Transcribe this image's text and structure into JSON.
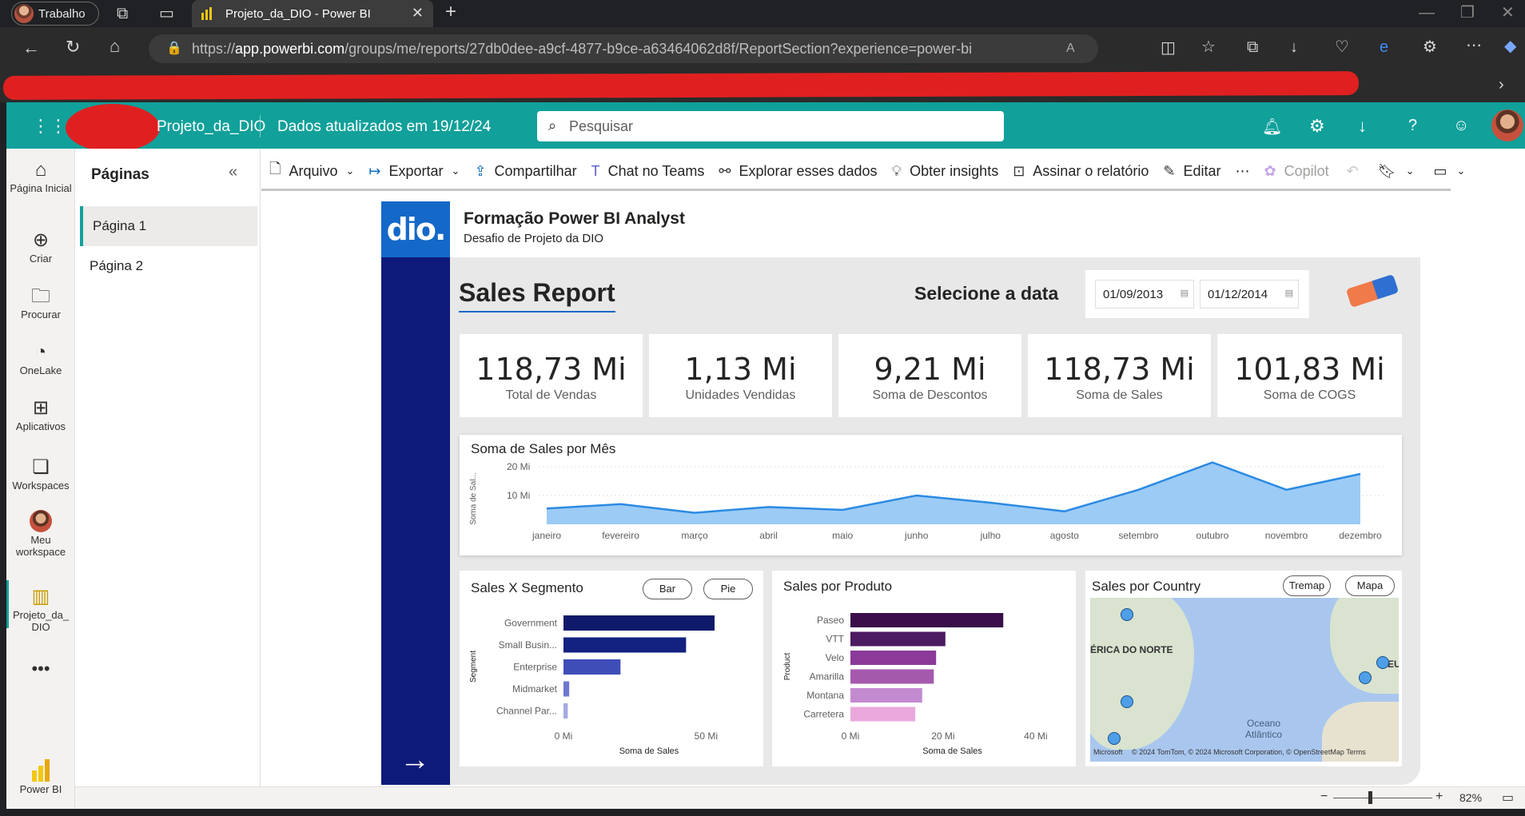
{
  "browser": {
    "profile": "Trabalho",
    "tab_title": "Projeto_da_DIO - Power BI",
    "url_prefix": "https://",
    "url_host": "app.powerbi.com",
    "url_path": "/groups/me/reports/27db0dee-a9cf-4877-b9ce-a63464062d8f/ReportSection?experience=power-bi"
  },
  "header": {
    "report_name": "Projeto_da_DIO",
    "refresh_text": "Dados atualizados em 19/12/24",
    "search_placeholder": "Pesquisar"
  },
  "rail": [
    {
      "label": "Página Inicial",
      "icon": "home-icon"
    },
    {
      "label": "Criar",
      "icon": "plus-circle-icon"
    },
    {
      "label": "Procurar",
      "icon": "folder-icon"
    },
    {
      "label": "OneLake",
      "icon": "onelake-icon"
    },
    {
      "label": "Aplicativos",
      "icon": "apps-icon"
    },
    {
      "label": "Workspaces",
      "icon": "workspaces-icon"
    },
    {
      "label": "Meu workspace",
      "icon": "avatar-icon"
    },
    {
      "label": "Projeto_da_ DIO",
      "icon": "report-icon"
    },
    {
      "label": "Power BI",
      "icon": "powerbi-icon"
    }
  ],
  "pages_pane": {
    "title": "Páginas",
    "pages": [
      "Página 1",
      "Página 2"
    ]
  },
  "toolbar": {
    "arquivo": "Arquivo",
    "exportar": "Exportar",
    "compartilhar": "Compartilhar",
    "teams": "Chat no Teams",
    "explorar": "Explorar esses dados",
    "insights": "Obter insights",
    "assinar": "Assinar o relatório",
    "editar": "Editar",
    "copilot": "Copilot"
  },
  "report": {
    "logo": "dio.",
    "title": "Formação Power BI Analyst",
    "subtitle": "Desafio de Projeto da DIO",
    "heading": "Sales Report",
    "date_label": "Selecione a data",
    "date_from": "01/09/2013",
    "date_to": "01/12/2014",
    "kpis": [
      {
        "value": "118,73 Mi",
        "label": "Total de Vendas"
      },
      {
        "value": "1,13 Mi",
        "label": "Unidades Vendidas"
      },
      {
        "value": "9,21 Mi",
        "label": "Soma de Descontos"
      },
      {
        "value": "118,73 Mi",
        "label": "Soma de  Sales"
      },
      {
        "value": "101,83 Mi",
        "label": "Soma de COGS"
      }
    ]
  },
  "chart_data": [
    {
      "type": "area",
      "title": "Soma de Sales por Mês",
      "ylabel": "Soma de Sal...",
      "y_ticks": [
        "20 Mi",
        "10 Mi"
      ],
      "categories": [
        "janeiro",
        "fevereiro",
        "março",
        "abril",
        "maio",
        "junho",
        "julho",
        "agosto",
        "setembro",
        "outubro",
        "novembro",
        "dezembro"
      ],
      "values": [
        5.5,
        7,
        4,
        6,
        5,
        10,
        7.5,
        4.5,
        12,
        21.5,
        12,
        17.5
      ],
      "ylim": [
        0,
        25
      ],
      "color": "#2b8ae3",
      "fill": "#9ccbf5"
    },
    {
      "type": "bar",
      "title": "Sales X Segmento",
      "ylabel": "Segment",
      "xlabel": "Soma de Sales",
      "x_ticks": [
        "0 Mi",
        "50 Mi"
      ],
      "categories": [
        "Government",
        "Small Busin...",
        "Enterprise",
        "Midmarket",
        "Channel Par..."
      ],
      "values": [
        53,
        43,
        20,
        2,
        1.5
      ],
      "xlim": [
        0,
        60
      ],
      "colors": [
        "#0f1a6b",
        "#132180",
        "#3f4db8",
        "#6d78d0",
        "#a3aae2"
      ],
      "buttons": [
        "Bar",
        "Pie"
      ]
    },
    {
      "type": "bar",
      "title": "Sales por Produto",
      "ylabel": "Product",
      "xlabel": "Soma de Sales",
      "x_ticks": [
        "0 Mi",
        "20 Mi",
        "40 Mi"
      ],
      "categories": [
        "Paseo",
        "VTT",
        "Velo",
        "Amarilla",
        "Montana",
        "Carretera"
      ],
      "values": [
        33,
        20.5,
        18.5,
        18,
        15.5,
        14
      ],
      "xlim": [
        0,
        44
      ],
      "colors": [
        "#3a0f4a",
        "#4b1a60",
        "#8b3a9a",
        "#a559ad",
        "#c48ad0",
        "#eaa8dc"
      ]
    }
  ],
  "map": {
    "title": "Sales por Country",
    "buttons": [
      "Tremap",
      "Mapa"
    ],
    "labels": [
      "ÉRICA DO NORTE",
      "EU",
      "Oceano Atlântico"
    ],
    "copyright": "© 2024 TomTom, © 2024 Microsoft Corporation, © OpenStreetMap  Terms",
    "ms_logo": "Microsoft"
  },
  "status": {
    "zoom": "82%"
  }
}
